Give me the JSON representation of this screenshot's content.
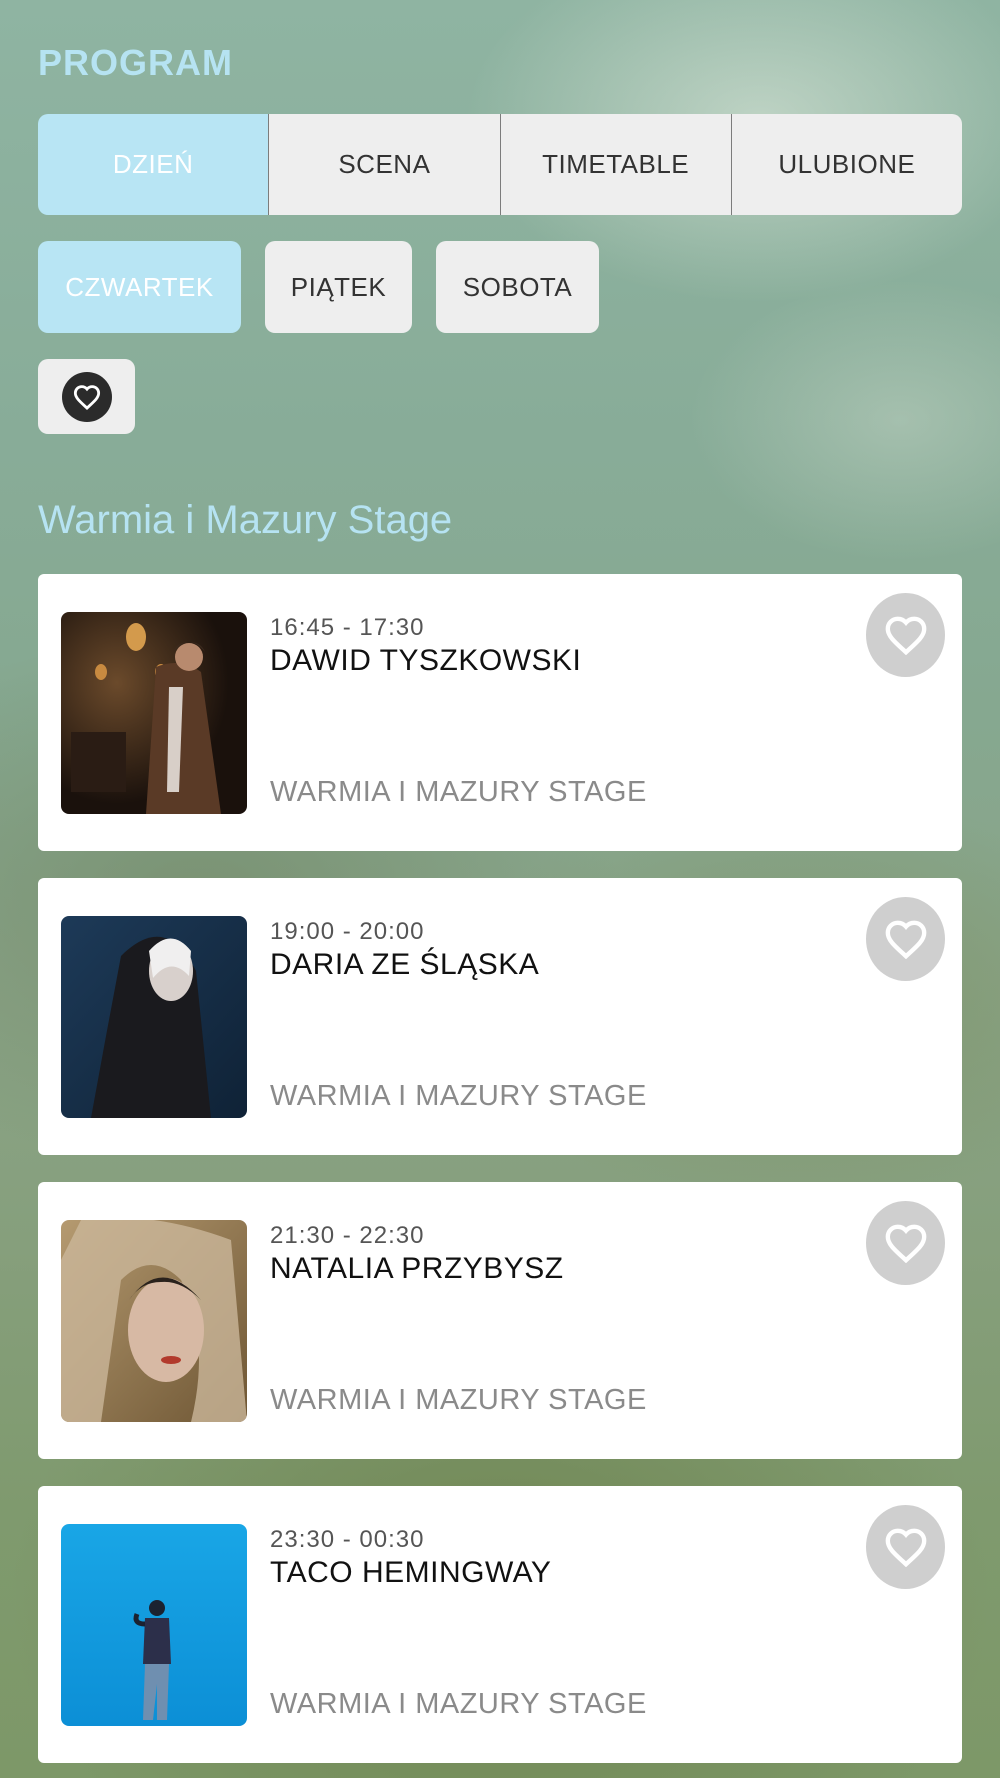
{
  "header": {
    "title": "PROGRAM"
  },
  "view_tabs": [
    {
      "label": "DZIEŃ",
      "active": true
    },
    {
      "label": "SCENA",
      "active": false
    },
    {
      "label": "TIMETABLE",
      "active": false
    },
    {
      "label": "ULUBIONE",
      "active": false
    }
  ],
  "day_tabs": [
    {
      "label": "CZWARTEK",
      "active": true
    },
    {
      "label": "PIĄTEK",
      "active": false
    },
    {
      "label": "SOBOTA",
      "active": false
    }
  ],
  "favorites_filter": {
    "icon": "heart-icon"
  },
  "stage_section": {
    "title": "Warmia i Mazury Stage"
  },
  "events": [
    {
      "time": "16:45 - 17:30",
      "artist": "DAWID TYSZKOWSKI",
      "stage": "WARMIA I MAZURY STAGE",
      "favorite_icon": "heart-outline-icon"
    },
    {
      "time": "19:00 - 20:00",
      "artist": "DARIA ZE ŚLĄSKA",
      "stage": "WARMIA I MAZURY STAGE",
      "favorite_icon": "heart-outline-icon"
    },
    {
      "time": "21:30 - 22:30",
      "artist": "NATALIA PRZYBYSZ",
      "stage": "WARMIA I MAZURY STAGE",
      "favorite_icon": "heart-outline-icon"
    },
    {
      "time": "23:30 - 00:30",
      "artist": "TACO HEMINGWAY",
      "stage": "WARMIA I MAZURY STAGE",
      "favorite_icon": "heart-outline-icon"
    }
  ],
  "colors": {
    "accent": "#b8e5f4",
    "inactive_tab": "#eeeeee",
    "heart_button": "#cfcfcf"
  }
}
